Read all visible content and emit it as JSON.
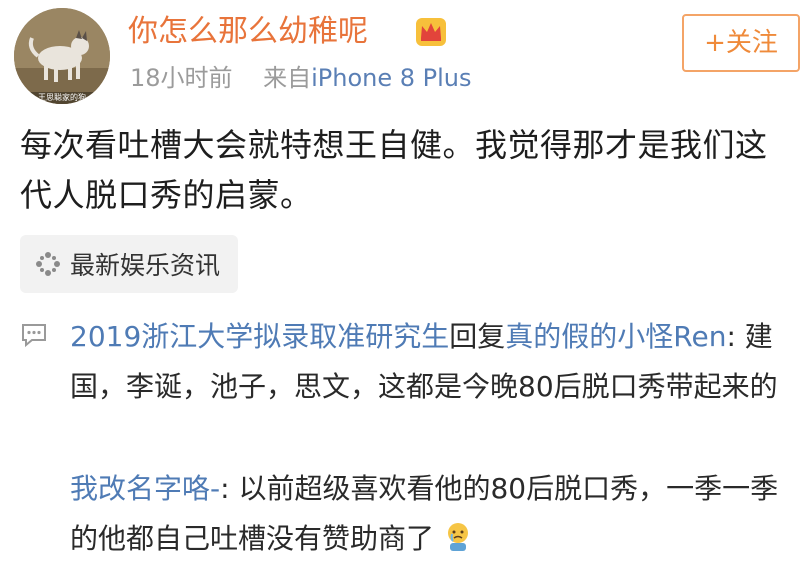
{
  "header": {
    "username": "你怎么那么幼稚呢",
    "time": "18小时前",
    "source_prefix": "来自",
    "source_device": "iPhone 8 Plus",
    "follow_label": "+关注",
    "avatar_caption": "王思聪家的狗",
    "badge_icon": "crown-icon"
  },
  "post": {
    "text": "每次看吐槽大会就特想王自健。我觉得那才是我们这代人脱口秀的启蒙。",
    "topic": "最新娱乐资讯",
    "topic_icon": "sparkle-icon"
  },
  "comments": [
    {
      "user": "2019浙江大学拟录取准研究生",
      "reply_word": "回复",
      "reply_to": "真的假的小怪Ren",
      "text": ": 建国，李诞，池子，思文，这都是今晚80后脱口秀带起来的"
    },
    {
      "user": "我改名字咯-",
      "text": ": 以前超级喜欢看他的80后脱口秀，一季一季的他都自己吐槽没有赞助商了",
      "emoji": "crying-emoji-icon"
    }
  ],
  "colors": {
    "username": "#e8743b",
    "link": "#4f7bb5",
    "meta": "#9b9b9b",
    "follow_border": "#f4a467"
  }
}
